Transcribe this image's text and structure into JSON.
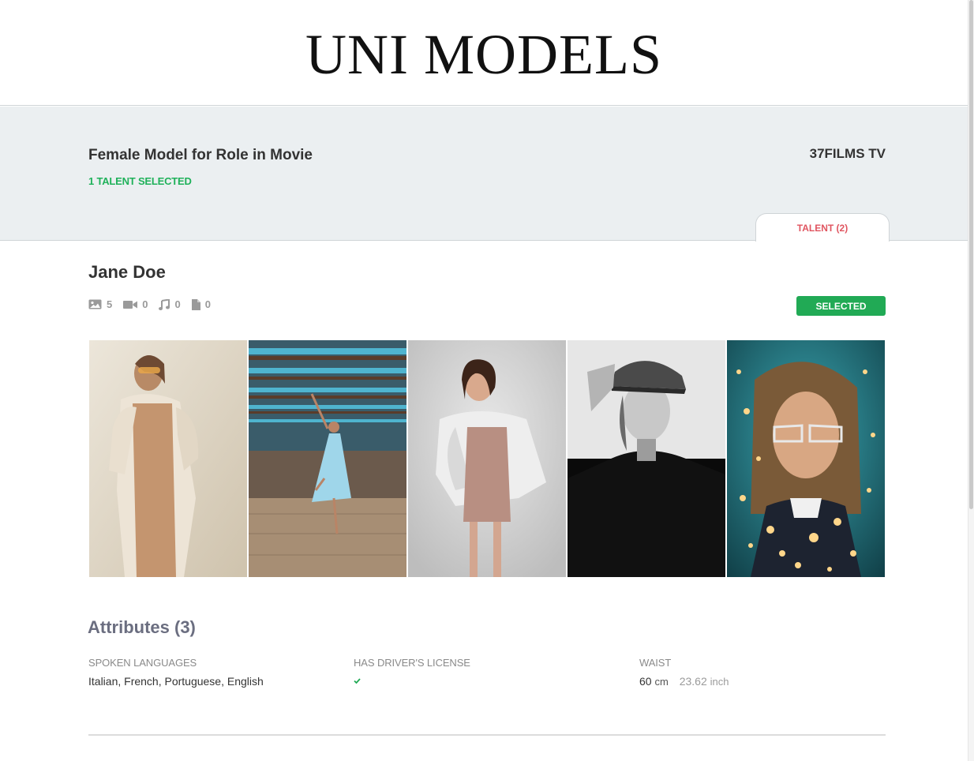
{
  "header": {
    "logo": "UNI MODELS"
  },
  "project": {
    "title": "Female Model for Role in Movie",
    "selected_count": "1 TALENT SELECTED",
    "client": "37FILMS TV",
    "tab_label": "TALENT (2)"
  },
  "talent": {
    "name": "Jane Doe",
    "media": {
      "photos": "5",
      "videos": "0",
      "audio": "0",
      "documents": "0"
    },
    "status_button": "SELECTED",
    "photos": [
      {
        "alt": "photo-1"
      },
      {
        "alt": "photo-2"
      },
      {
        "alt": "photo-3"
      },
      {
        "alt": "photo-4"
      },
      {
        "alt": "photo-5"
      }
    ]
  },
  "attributes": {
    "title": "Attributes (3)",
    "spoken_languages": {
      "label": "SPOKEN LANGUAGES",
      "value": "Italian, French, Portuguese, English"
    },
    "drivers_license": {
      "label": "HAS DRIVER'S LICENSE",
      "value": true
    },
    "waist": {
      "label": "WAIST",
      "value": "60",
      "unit": "cm",
      "alt_value": "23.62",
      "alt_unit": "inch"
    }
  },
  "colors": {
    "accent_green": "#21aa55",
    "selected_text_green": "#1fb15a",
    "tab_red": "#e05560",
    "band_grey": "#ebeff1"
  }
}
